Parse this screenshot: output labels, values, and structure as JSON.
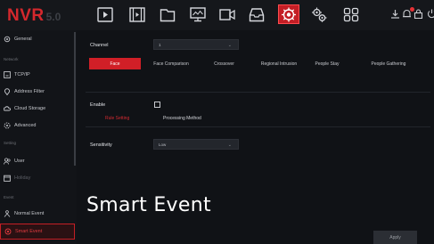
{
  "app": {
    "brand": "NVR",
    "version": "5.0"
  },
  "topbar": {
    "icons": [
      "playback-icon",
      "video-file-icon",
      "folder-icon",
      "monitor-icon",
      "camera-icon",
      "storage-icon",
      "smart-event-icon",
      "settings-icon",
      "grid-icon"
    ],
    "active_icon": "smart-event-icon",
    "right_icons": [
      "download-icon",
      "alarm-icon",
      "lock-icon"
    ],
    "alarm_color": "#e53236"
  },
  "sidebar": {
    "items": [
      {
        "label": "General",
        "icon": "gear-icon"
      },
      {
        "section": "Network"
      },
      {
        "label": "TCP/IP",
        "icon": "network-icon"
      },
      {
        "label": "Address Filter",
        "icon": "location-icon"
      },
      {
        "label": "Cloud Storage",
        "icon": "cloud-icon"
      },
      {
        "label": "Advanced",
        "icon": "advanced-icon"
      },
      {
        "section": "Setting"
      },
      {
        "label": "User",
        "icon": "users-icon"
      },
      {
        "label": "Holiday",
        "icon": "calendar-icon"
      },
      {
        "section": "Event"
      },
      {
        "label": "Normal Event",
        "icon": "event-icon"
      },
      {
        "label": "Smart Event",
        "icon": "smart-event-icon",
        "active": true
      }
    ]
  },
  "main": {
    "channel_label": "Channel",
    "channel_value": "1",
    "tabs": [
      "Face",
      "Face Comparison",
      "Crossover",
      "Regional Intrusion",
      "People Stay",
      "People Gathering"
    ],
    "active_tab": "Face",
    "enable_label": "Enable",
    "enable_checked": false,
    "subtabs": [
      "Rule Setting",
      "Processing Method"
    ],
    "active_subtab": "Rule Setting",
    "sensitivity_label": "Sensitivity",
    "sensitivity_value": "Low",
    "apply_label": "Apply"
  },
  "overlay_title": "Smart Event",
  "colors": {
    "accent": "#d11f27",
    "background": "#101216"
  }
}
